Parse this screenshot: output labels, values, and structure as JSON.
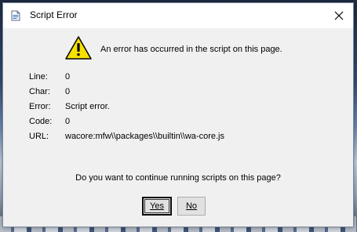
{
  "window": {
    "title": "Script Error",
    "close_symbol": "✕",
    "title_icon": "script-page-icon",
    "warning_icon": "warning-triangle-icon"
  },
  "message": "An error has occurred in the script on this page.",
  "details": [
    {
      "label": "Line:",
      "value": "0"
    },
    {
      "label": "Char:",
      "value": "0"
    },
    {
      "label": "Error:",
      "value": "Script error."
    },
    {
      "label": "Code:",
      "value": "0"
    },
    {
      "label": "URL:",
      "value": "wacore:mfw\\\\packages\\\\builtin\\\\wa-core.js"
    }
  ],
  "question": "Do you want to continue running scripts on this page?",
  "buttons": {
    "yes_label": "Yes",
    "no_label": "No"
  },
  "colors": {
    "warning_fill": "#f5e000",
    "warning_outline": "#000000",
    "dialog_bg": "#f0f0f0"
  }
}
